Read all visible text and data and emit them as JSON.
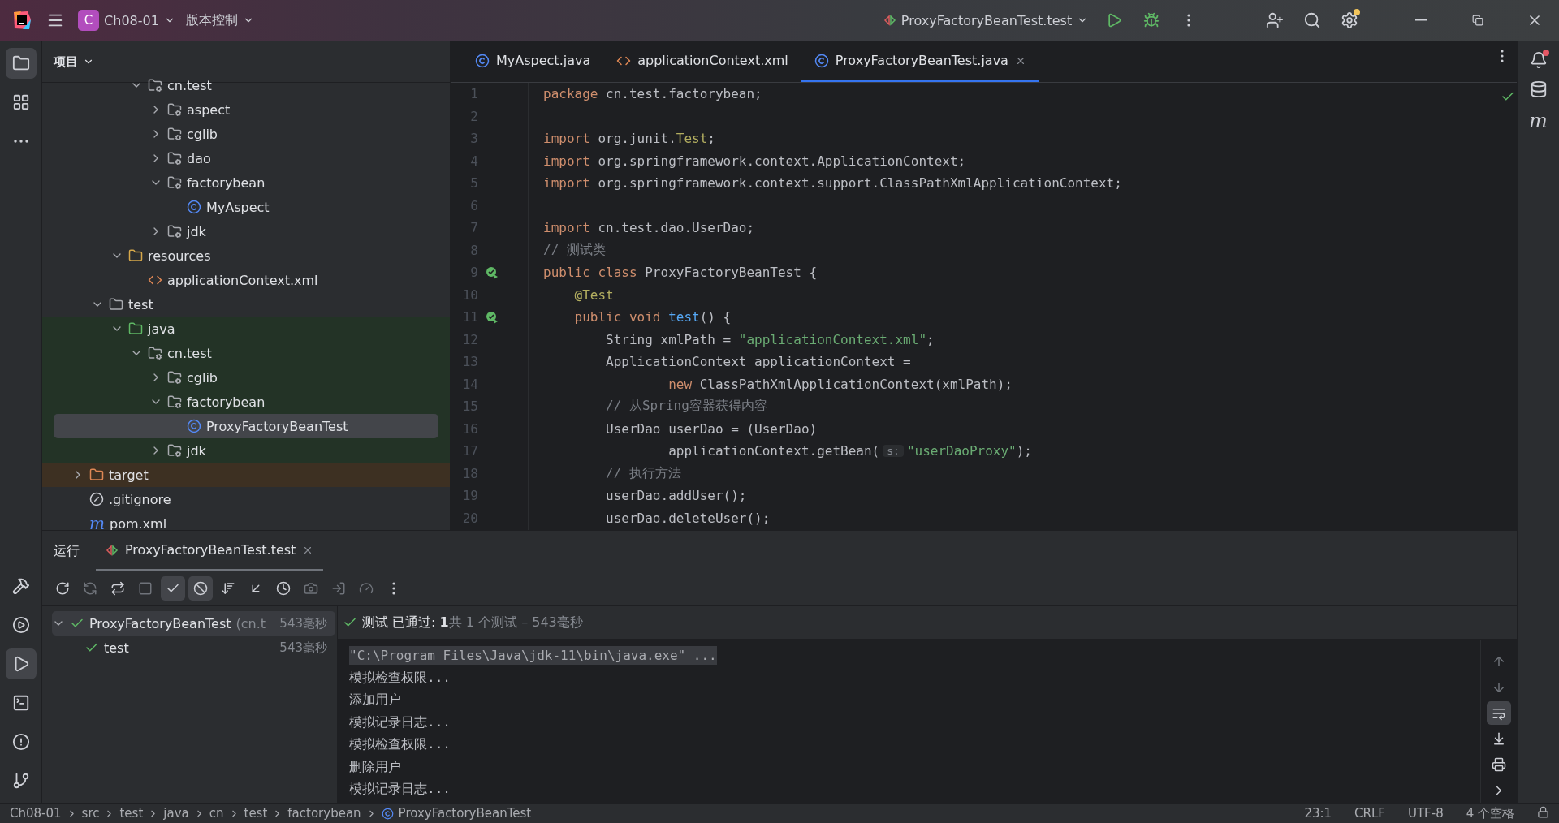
{
  "title_bar": {
    "project_badge": "C",
    "project": "Ch08-01",
    "vcs": "版本控制",
    "run_config": "ProxyFactoryBeanTest.test"
  },
  "left_strip": {
    "top": [
      {
        "selected": true
      },
      {
        "selected": false
      },
      {
        "selected": false
      }
    ],
    "bottom": [
      {
        "selected": false
      },
      {
        "selected": false
      },
      {
        "selected": true
      },
      {
        "selected": false
      },
      {
        "selected": false
      },
      {
        "selected": false
      }
    ]
  },
  "project_panel": {
    "title": "项目",
    "tree": [
      {
        "children": [
          {
            "children": [
              {
                "children": [
                  {
                    "label": "cn.test",
                    "kind": "package",
                    "expanded": true,
                    "selected": false,
                    "children": [
                      {
                        "label": "aspect",
                        "kind": "package",
                        "expanded": false,
                        "selected": false
                      },
                      {
                        "label": "cglib",
                        "kind": "package",
                        "expanded": false,
                        "selected": false
                      },
                      {
                        "label": "dao",
                        "kind": "package",
                        "expanded": false,
                        "selected": false
                      },
                      {
                        "label": "factorybean",
                        "kind": "package",
                        "expanded": true,
                        "selected": false,
                        "children": [
                          {
                            "label": "MyAspect",
                            "kind": "class",
                            "selected": false
                          }
                        ]
                      },
                      {
                        "label": "jdk",
                        "kind": "package",
                        "expanded": false,
                        "selected": false
                      }
                    ]
                  }
                ]
              },
              {
                "label": "resources",
                "kind": "resources",
                "expanded": true,
                "selected": false,
                "children": [
                  {
                    "label": "applicationContext.xml",
                    "kind": "xml",
                    "selected": false
                  }
                ]
              }
            ]
          },
          {
            "label": "test",
            "kind": "folder",
            "expanded": true,
            "selected": false,
            "children": [
              {
                "label": "java",
                "kind": "test-root",
                "test_source": true,
                "expanded": true,
                "selected": false,
                "children": [
                  {
                    "label": "cn.test",
                    "kind": "package",
                    "expanded": true,
                    "selected": false,
                    "children": [
                      {
                        "label": "cglib",
                        "kind": "package",
                        "expanded": false,
                        "selected": false
                      },
                      {
                        "label": "factorybean",
                        "kind": "package",
                        "expanded": true,
                        "selected": false,
                        "children": [
                          {
                            "label": "ProxyFactoryBeanTest",
                            "kind": "class",
                            "selected": true
                          }
                        ]
                      },
                      {
                        "label": "jdk",
                        "kind": "package",
                        "expanded": false,
                        "selected": false
                      }
                    ]
                  }
                ]
              }
            ]
          }
        ]
      },
      {
        "label": "target",
        "kind": "excluded",
        "excluded": true,
        "expanded": false,
        "selected": false
      },
      {
        "label": ".gitignore",
        "kind": "ignore",
        "selected": false
      },
      {
        "label": "pom.xml",
        "kind": "maven",
        "glyph": "m",
        "selected": false
      }
    ]
  },
  "editor": {
    "tabs": [
      {
        "label": "MyAspect.java",
        "kind": "class",
        "selected": false
      },
      {
        "label": "applicationContext.xml",
        "kind": "xml",
        "selected": false
      },
      {
        "label": "ProxyFactoryBeanTest.java",
        "kind": "class",
        "selected": true
      }
    ],
    "lines": [
      {
        "n": "1",
        "gutter": false,
        "tokens": [
          {
            "kind": "kw",
            "text": "package"
          },
          {
            "kind": "pl",
            "text": " cn.test.factorybean;"
          }
        ]
      },
      {
        "n": "2",
        "gutter": false
      },
      {
        "n": "3",
        "gutter": false,
        "tokens": [
          {
            "kind": "kw",
            "text": "import"
          },
          {
            "kind": "pl",
            "text": " org.junit."
          },
          {
            "kind": "ann",
            "text": "Test"
          },
          {
            "kind": "pl",
            "text": ";"
          }
        ]
      },
      {
        "n": "4",
        "gutter": false,
        "tokens": [
          {
            "kind": "kw",
            "text": "import"
          },
          {
            "kind": "pl",
            "text": " org.springframework.context.ApplicationContext;"
          }
        ]
      },
      {
        "n": "5",
        "gutter": false,
        "tokens": [
          {
            "kind": "kw",
            "text": "import"
          },
          {
            "kind": "pl",
            "text": " org.springframework.context.support.ClassPathXmlApplicationContext;"
          }
        ]
      },
      {
        "n": "6",
        "gutter": false
      },
      {
        "n": "7",
        "gutter": false,
        "tokens": [
          {
            "kind": "kw",
            "text": "import"
          },
          {
            "kind": "pl",
            "text": " cn.test.dao.UserDao;"
          }
        ]
      },
      {
        "n": "8",
        "gutter": false,
        "tokens": [
          {
            "kind": "com",
            "text": "// 测试类"
          }
        ]
      },
      {
        "n": "9",
        "gutter": true,
        "tokens": [
          {
            "kind": "kw",
            "text": "public class"
          },
          {
            "kind": "pl",
            "text": " ProxyFactoryBeanTest {"
          }
        ]
      },
      {
        "n": "10",
        "gutter": false,
        "tokens": [
          {
            "kind": "ann",
            "text": "    @Test"
          }
        ]
      },
      {
        "n": "11",
        "gutter": true,
        "tokens": [
          {
            "kind": "kw",
            "text": "    public void"
          },
          {
            "kind": "fn",
            "text": " test"
          },
          {
            "kind": "pl",
            "text": "() {"
          }
        ]
      },
      {
        "n": "12",
        "gutter": false,
        "tokens": [
          {
            "kind": "pl",
            "text": "        String xmlPath = "
          },
          {
            "kind": "str",
            "text": "\"applicationContext.xml\""
          },
          {
            "kind": "pl",
            "text": ";"
          }
        ]
      },
      {
        "n": "13",
        "gutter": false,
        "tokens": [
          {
            "kind": "pl",
            "text": "        ApplicationContext applicationContext ="
          }
        ]
      },
      {
        "n": "14",
        "gutter": false,
        "tokens": [
          {
            "kind": "kw",
            "text": "                new"
          },
          {
            "kind": "pl",
            "text": " ClassPathXmlApplicationContext(xmlPath);"
          }
        ]
      },
      {
        "n": "15",
        "gutter": false,
        "tokens": [
          {
            "kind": "com",
            "text": "        // 从Spring容器获得内容"
          }
        ]
      },
      {
        "n": "16",
        "gutter": false,
        "tokens": [
          {
            "kind": "pl",
            "text": "        UserDao userDao = (UserDao)"
          }
        ]
      },
      {
        "n": "17",
        "gutter": false,
        "tokens": [
          {
            "kind": "pl",
            "text": "                applicationContext.getBean("
          },
          {
            "kind": "hint",
            "text": "s:"
          },
          {
            "kind": "str",
            "text": "\"userDaoProxy\""
          },
          {
            "kind": "pl",
            "text": ");"
          }
        ]
      },
      {
        "n": "18",
        "gutter": false,
        "tokens": [
          {
            "kind": "com",
            "text": "        // 执行方法"
          }
        ]
      },
      {
        "n": "19",
        "gutter": false,
        "tokens": [
          {
            "kind": "pl",
            "text": "        userDao.addUser();"
          }
        ]
      },
      {
        "n": "20",
        "gutter": false,
        "tokens": [
          {
            "kind": "pl",
            "text": "        userDao.deleteUser();"
          }
        ]
      }
    ]
  },
  "right_strip": {
    "maven_glyph": "m"
  },
  "run_panel": {
    "title": "运行",
    "tabs": [
      {
        "label": "ProxyFactoryBeanTest.test",
        "selected": true
      }
    ],
    "toolbar": [
      {
        "disabled": false,
        "on": false
      },
      {
        "disabled": true,
        "on": false
      },
      {
        "disabled": false,
        "on": false
      },
      {
        "disabled": true,
        "on": false
      },
      {
        "disabled": false,
        "on": true
      },
      {
        "disabled": false,
        "on": true
      },
      {
        "disabled": false,
        "on": false
      },
      {
        "disabled": false,
        "on": false
      },
      {
        "disabled": false,
        "on": false
      },
      {
        "disabled": true,
        "on": false
      },
      {
        "disabled": true,
        "on": false
      },
      {
        "disabled": true,
        "on": false
      }
    ],
    "tests": [
      {
        "label": "ProxyFactoryBeanTest",
        "detail": "(cn.t",
        "time": "543毫秒",
        "expanded": true,
        "selected": true,
        "children": [
          {
            "label": "test",
            "time": "543毫秒",
            "selected": false
          }
        ]
      }
    ],
    "status": {
      "label": "测试 已通过:",
      "count": "1",
      "summary": "共 1 个测试 – 543毫秒"
    },
    "console": [
      {
        "kind": "command",
        "text": "\"C:\\Program Files\\Java\\jdk-11\\bin\\java.exe\" ..."
      },
      {
        "kind": "out",
        "text": "模拟检查权限..."
      },
      {
        "kind": "out",
        "text": "添加用户"
      },
      {
        "kind": "out",
        "text": "模拟记录日志..."
      },
      {
        "kind": "out",
        "text": "模拟检查权限..."
      },
      {
        "kind": "out",
        "text": "删除用户"
      },
      {
        "kind": "out",
        "text": "模拟记录日志..."
      }
    ],
    "side_tools": [
      {
        "disabled": true,
        "on": false
      },
      {
        "disabled": true,
        "on": false
      },
      {
        "disabled": false,
        "on": true
      },
      {
        "disabled": false,
        "on": false
      },
      {
        "disabled": false,
        "on": false
      },
      {
        "disabled": false,
        "on": false
      }
    ]
  },
  "status_bar": {
    "breadcrumbs": [
      "Ch08-01",
      "src",
      "test",
      "java",
      "cn",
      "test",
      "factorybean",
      "ProxyFactoryBeanTest"
    ],
    "position": "23:1",
    "line_ending": "CRLF",
    "encoding": "UTF-8",
    "indent": "4 个空格"
  }
}
